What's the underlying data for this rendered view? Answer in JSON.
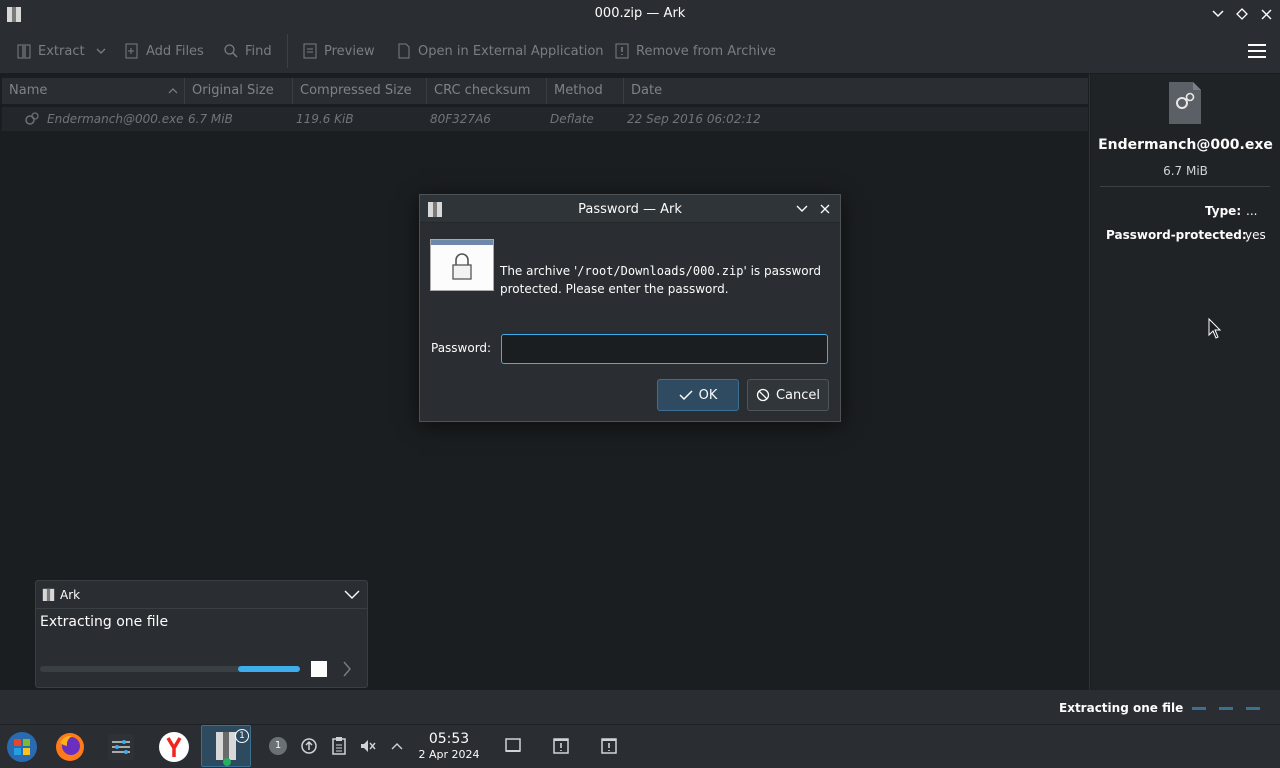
{
  "window": {
    "title": "000.zip — Ark"
  },
  "toolbar": {
    "extract": "Extract",
    "add_files": "Add Files",
    "find": "Find",
    "preview": "Preview",
    "open_external": "Open in External Application",
    "remove": "Remove from Archive"
  },
  "columns": [
    "Name",
    "Original Size",
    "Compressed Size",
    "CRC checksum",
    "Method",
    "Date"
  ],
  "files": [
    {
      "name": "Endermanch@000.exe",
      "original_size": "6.7 MiB",
      "compressed_size": "119.6 KiB",
      "crc": "80F327A6",
      "method": "Deflate",
      "date": "22 Sep 2016 06:02:12"
    }
  ],
  "details": {
    "filename": "Endermanch@000.exe",
    "size": "6.7 MiB",
    "type_label": "Type:",
    "type_value": "...",
    "pw_label": "Password-protected:",
    "pw_value": "yes"
  },
  "dialog": {
    "title": "Password — Ark",
    "message_before": "The archive '",
    "path": "/root/Downloads/000.zip",
    "message_after": "' is password protected. Please enter the password.",
    "password_label": "Password:",
    "password_value": "",
    "ok": "OK",
    "cancel": "Cancel"
  },
  "notification": {
    "app": "Ark",
    "text": "Extracting one file",
    "progress_fraction": 0.24
  },
  "statusbar": {
    "text": "Extracting one file"
  },
  "taskbar": {
    "ark_badge": "1",
    "tray_badge": "1",
    "time": "05:53",
    "date": "2 Apr 2024"
  },
  "colors": {
    "accent": "#3daee9",
    "background": "#1b1e20",
    "panel": "#2a2e32"
  }
}
